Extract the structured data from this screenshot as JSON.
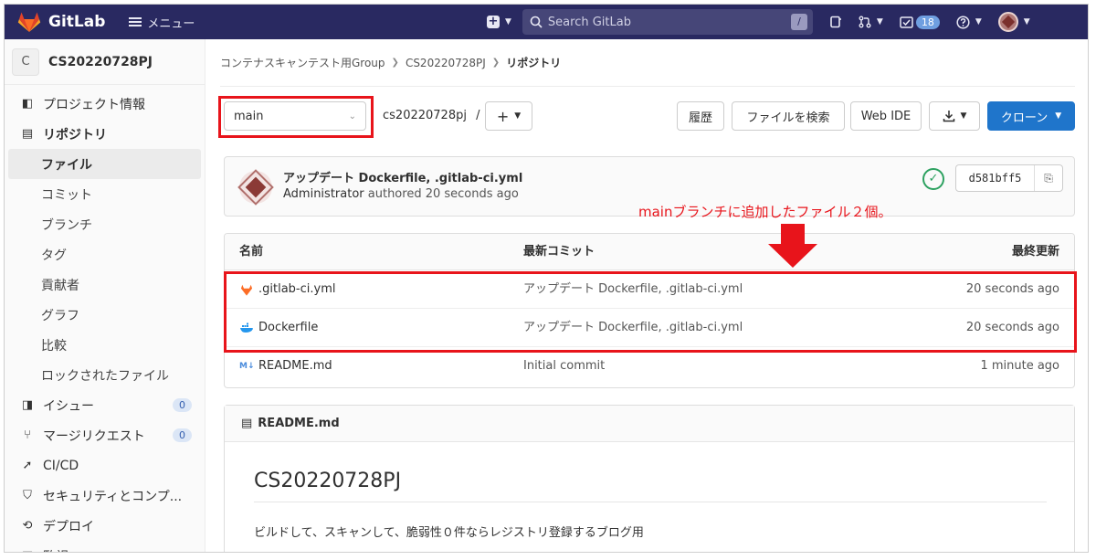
{
  "header": {
    "brand": "GitLab",
    "menu_label": "メニュー",
    "search_placeholder": "Search GitLab",
    "search_shortcut": "/",
    "todo_count": "18"
  },
  "sidebar": {
    "project_initial": "C",
    "project_name": "CS20220728PJ",
    "items": [
      {
        "label": "プロジェクト情報",
        "icon": "info-icon"
      },
      {
        "label": "リポジトリ",
        "icon": "document-icon"
      },
      {
        "label": "ファイル"
      },
      {
        "label": "コミット"
      },
      {
        "label": "ブランチ"
      },
      {
        "label": "タグ"
      },
      {
        "label": "貢献者"
      },
      {
        "label": "グラフ"
      },
      {
        "label": "比較"
      },
      {
        "label": "ロックされたファイル"
      },
      {
        "label": "イシュー",
        "icon": "issues-icon",
        "count": "0"
      },
      {
        "label": "マージリクエスト",
        "icon": "merge-request-icon",
        "count": "0"
      },
      {
        "label": "CI/CD",
        "icon": "rocket-icon"
      },
      {
        "label": "セキュリティとコンプ...",
        "icon": "shield-icon"
      },
      {
        "label": "デプロイ",
        "icon": "deploy-icon"
      },
      {
        "label": "監視",
        "icon": "monitor-icon"
      }
    ]
  },
  "breadcrumb": {
    "group": "コンテナスキャンテスト用Group",
    "project": "CS20220728PJ",
    "current": "リポジトリ"
  },
  "toolbar": {
    "branch": "main",
    "path": "cs20220728pj",
    "path_sep": "/",
    "add_label": "+",
    "history_label": "履歴",
    "find_file_label": "ファイルを検索",
    "web_ide_label": "Web IDE",
    "clone_label": "クローン"
  },
  "last_commit": {
    "title": "アップデート Dockerfile, .gitlab-ci.yml",
    "author": "Administrator",
    "action": "authored",
    "time": "20 seconds ago",
    "sha": "d581bff5"
  },
  "annotation": {
    "text": "mainブランチに追加したファイル２個。"
  },
  "file_table": {
    "headers": {
      "name": "名前",
      "last_commit": "最新コミット",
      "last_update": "最終更新"
    },
    "rows": [
      {
        "name": ".gitlab-ci.yml",
        "commit": "アップデート Dockerfile, .gitlab-ci.yml",
        "updated": "20 seconds ago",
        "icon": "gitlab-icon"
      },
      {
        "name": "Dockerfile",
        "commit": "アップデート Dockerfile, .gitlab-ci.yml",
        "updated": "20 seconds ago",
        "icon": "docker-icon"
      },
      {
        "name": "README.md",
        "commit": "Initial commit",
        "updated": "1 minute ago",
        "icon": "markdown-icon"
      }
    ]
  },
  "readme": {
    "file_name": "README.md",
    "title": "CS20220728PJ",
    "body": "ビルドして、スキャンして、脆弱性０件ならレジストリ登録するブログ用"
  },
  "colors": {
    "navbar": "#292961",
    "primary": "#1f75cb",
    "annotation": "#e8141b",
    "success": "#2da160"
  }
}
